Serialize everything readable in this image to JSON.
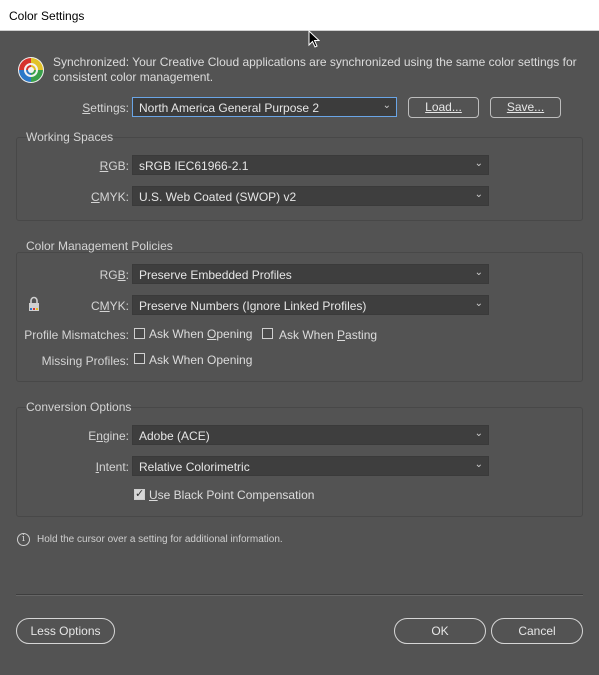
{
  "window": {
    "title": "Color Settings"
  },
  "sync": {
    "message": "Synchronized: Your Creative Cloud applications are synchronized using the same color settings for consistent color management."
  },
  "settings": {
    "label": "Settings:",
    "value": "North America General Purpose 2",
    "load_label": "Load...",
    "save_label": "Save..."
  },
  "working_spaces": {
    "title": "Working Spaces",
    "rgb_label": "RGB:",
    "rgb_value": "sRGB IEC61966-2.1",
    "cmyk_label": "CMYK:",
    "cmyk_value": "U.S. Web Coated (SWOP) v2"
  },
  "policies": {
    "title": "Color Management Policies",
    "rgb_label": "RGB:",
    "rgb_value": "Preserve Embedded Profiles",
    "cmyk_label": "CMYK:",
    "cmyk_value": "Preserve Numbers (Ignore Linked Profiles)",
    "mismatch_label": "Profile Mismatches:",
    "ask_opening": "Ask When Opening",
    "ask_pasting": "Ask When Pasting",
    "missing_label": "Missing Profiles:",
    "missing_ask_opening": "Ask When Opening"
  },
  "conversion": {
    "title": "Conversion Options",
    "engine_label": "Engine:",
    "engine_value": "Adobe (ACE)",
    "intent_label": "Intent:",
    "intent_value": "Relative Colorimetric",
    "bpc_label": "Use Black Point Compensation",
    "bpc_checked": true
  },
  "info": {
    "text": "Hold the cursor over a setting for additional information."
  },
  "footer": {
    "less_options": "Less Options",
    "ok": "OK",
    "cancel": "Cancel"
  }
}
